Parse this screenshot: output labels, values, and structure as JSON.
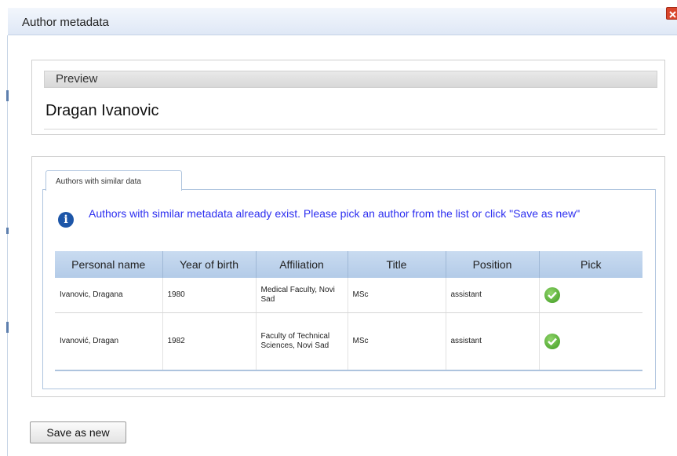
{
  "dialog": {
    "title": "Author metadata",
    "close_icon": "close-icon"
  },
  "preview": {
    "header": "Preview",
    "name": "Dragan Ivanovic"
  },
  "similar": {
    "tab_label": "Authors with similar data",
    "info_icon": "info-icon",
    "message": "Authors with similar metadata already exist. Please pick an author from the list or click \"Save as new\"",
    "columns": [
      "Personal name",
      "Year of birth",
      "Affiliation",
      "Title",
      "Position",
      "Pick"
    ],
    "rows": [
      {
        "personal_name": "Ivanovic, Dragana",
        "year_of_birth": "1980",
        "affiliation": "Medical Faculty, Novi Sad",
        "title": "MSc",
        "position": "assistant",
        "pick_icon": "check-icon"
      },
      {
        "personal_name": "Ivanović, Dragan",
        "year_of_birth": "1982",
        "affiliation": "Faculty of Technical Sciences, Novi Sad",
        "title": "MSc",
        "position": "assistant",
        "pick_icon": "check-icon"
      }
    ]
  },
  "footer": {
    "save_as_new": "Save as new"
  },
  "colors": {
    "accent": "#1d56a8",
    "message_text": "#2d2ff0",
    "table_header": "#c9dbf0",
    "pick_green": "#3f9b21"
  }
}
